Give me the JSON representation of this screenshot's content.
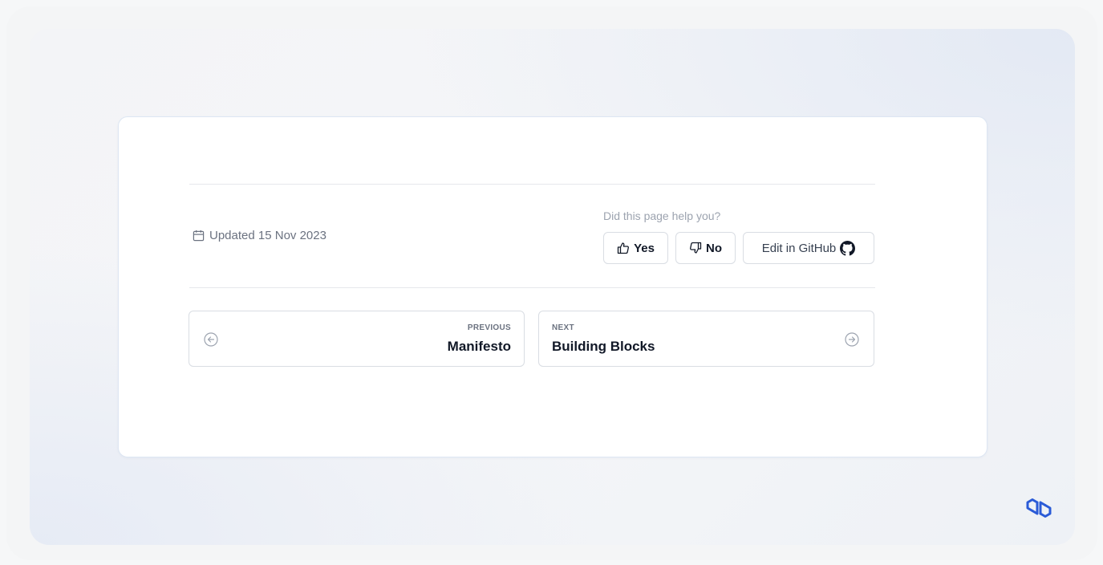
{
  "footer": {
    "updated_text": "Updated 15 Nov 2023",
    "feedback": {
      "question": "Did this page help you?",
      "yes_label": "Yes",
      "no_label": "No",
      "github_label": "Edit in GitHub"
    }
  },
  "pagination": {
    "previous": {
      "small_label": "PREVIOUS",
      "title": "Manifesto"
    },
    "next": {
      "small_label": "NEXT",
      "title": "Building Blocks"
    }
  },
  "icons": {
    "calendar": "calendar-icon",
    "thumbs_up": "thumbs-up-icon",
    "thumbs_down": "thumbs-down-icon",
    "github": "github-icon",
    "arrow_left": "arrow-left-circle-icon",
    "arrow_right": "arrow-right-circle-icon",
    "logo": "brand-logo-icon"
  },
  "colors": {
    "brand": "#2a5bd7",
    "text_primary": "#111827",
    "text_muted": "#6b7280",
    "border": "#d9dde3"
  }
}
